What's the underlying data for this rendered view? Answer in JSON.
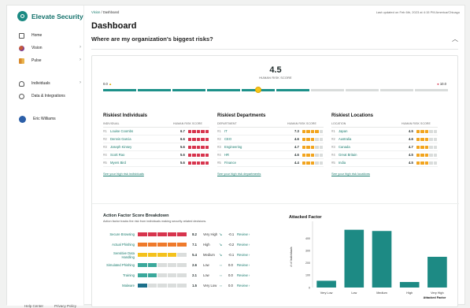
{
  "brand": {
    "name": "Elevate Security",
    "accent": "#1b8a83"
  },
  "sidebar": {
    "items": [
      {
        "label": "Home",
        "icon": "home-icon",
        "chevron": false
      },
      {
        "label": "Vision",
        "icon": "vision-icon",
        "chevron": true
      },
      {
        "label": "Pulse",
        "icon": "pulse-icon",
        "chevron": true
      },
      {
        "label": "Individuals",
        "icon": "people-icon",
        "chevron": true
      },
      {
        "label": "Data & Integrations",
        "icon": "data-icon",
        "chevron": false
      }
    ],
    "user": {
      "name": "Eric Williams"
    },
    "footer": [
      "Help Center",
      "Privacy Policy"
    ]
  },
  "header": {
    "breadcrumb": {
      "root": "Vision",
      "sep": "/",
      "current": "Dashboard"
    },
    "updated": "Last updated on Feb 6th, 2023 at 4:15 PM America/Chicago",
    "title": "Dashboard",
    "subtitle": "Where are my organization's biggest risks?",
    "collapse_glyph": "︿"
  },
  "human_risk": {
    "score": "4.5",
    "label": "HUMAN RISK SCORE",
    "min": "0.0",
    "max": "10.0",
    "segments": 10,
    "filled": 6,
    "value_fraction": 0.45
  },
  "risky": {
    "bar_colors": {
      "high": "#d7344d",
      "mid": "#f2a41d",
      "off": "#d9dcdb"
    },
    "columns": [
      {
        "title": "Riskiest Individuals",
        "col1": "INDIVIDUAL",
        "col2": "HUMAN RISK SCORE",
        "link": "See your high risk individuals",
        "rows": [
          {
            "rank": "#1",
            "name": "Louise Coombs",
            "score": "6.7",
            "level": 5,
            "tone": "high"
          },
          {
            "rank": "#2",
            "name": "Dennis Garcia",
            "score": "6.6",
            "level": 5,
            "tone": "high"
          },
          {
            "rank": "#3",
            "name": "Joseph Kinsey",
            "score": "5.6",
            "level": 5,
            "tone": "high"
          },
          {
            "rank": "#4",
            "name": "Scott Rao",
            "score": "5.6",
            "level": 5,
            "tone": "high"
          },
          {
            "rank": "#5",
            "name": "Myers Bird",
            "score": "5.6",
            "level": 5,
            "tone": "high"
          }
        ]
      },
      {
        "title": "Riskiest Departments",
        "col1": "DEPARTMENT",
        "col2": "HUMAN RISK SCORE",
        "link": "See your high risk departments",
        "rows": [
          {
            "rank": "#1",
            "name": "IT",
            "score": "7.3",
            "level": 4,
            "tone": "mid"
          },
          {
            "rank": "#2",
            "name": "CEO",
            "score": "4.6",
            "level": 3,
            "tone": "mid"
          },
          {
            "rank": "#3",
            "name": "Engineering",
            "score": "4.7",
            "level": 3,
            "tone": "mid"
          },
          {
            "rank": "#4",
            "name": "HR",
            "score": "4.6",
            "level": 3,
            "tone": "mid"
          },
          {
            "rank": "#5",
            "name": "Finance",
            "score": "4.4",
            "level": 3,
            "tone": "mid"
          }
        ]
      },
      {
        "title": "Riskiest Locations",
        "col1": "LOCATION",
        "col2": "HUMAN RISK SCORE",
        "link": "See your high risk locations",
        "rows": [
          {
            "rank": "#1",
            "name": "Japan",
            "score": "4.5",
            "level": 3,
            "tone": "mid"
          },
          {
            "rank": "#2",
            "name": "Australia",
            "score": "4.6",
            "level": 3,
            "tone": "mid"
          },
          {
            "rank": "#3",
            "name": "Canada",
            "score": "4.7",
            "level": 3,
            "tone": "mid"
          },
          {
            "rank": "#4",
            "name": "Great Britain",
            "score": "4.5",
            "level": 3,
            "tone": "mid"
          },
          {
            "rank": "#5",
            "name": "India",
            "score": "4.5",
            "level": 3,
            "tone": "mid"
          }
        ]
      }
    ]
  },
  "action_factors": {
    "title": "Action Factor Score Breakdown",
    "description": "Action factor tracks the risk from individuals making security-related decisions.",
    "review_label": "Review ›",
    "rows": [
      {
        "name": "Secure Browsing",
        "score": "8.2",
        "level": "Very High",
        "delta": "-0.1",
        "filled": 5,
        "color": "#d7344d"
      },
      {
        "name": "Actual Phishing",
        "score": "7.1",
        "level": "High",
        "delta": "-0.2",
        "filled": 5,
        "color": "#ef7a2b"
      },
      {
        "name": "Sensitive Data Handling",
        "score": "5.4",
        "level": "Medium",
        "delta": "-0.1",
        "filled": 4,
        "color": "#f4c21c"
      },
      {
        "name": "Simulated Phishing",
        "score": "2.6",
        "level": "Low",
        "delta": "0.0",
        "filled": 2,
        "color": "#3aa89b"
      },
      {
        "name": "Training",
        "score": "2.1",
        "level": "Low",
        "delta": "0.0",
        "filled": 2,
        "color": "#3aa89b"
      },
      {
        "name": "Malware",
        "score": "1.5",
        "level": "Very Low",
        "delta": "0.0",
        "filled": 1,
        "color": "#1b6f8a"
      }
    ]
  },
  "chart_data": {
    "type": "bar",
    "title": "Attacked Factor",
    "ylabel": "# of Individuals",
    "xlabel": "Attacked Factor",
    "categories": [
      "Very Low",
      "Low",
      "Medium",
      "High",
      "Very High"
    ],
    "values": [
      55,
      470,
      460,
      45,
      250
    ],
    "ylim": [
      0,
      500
    ],
    "yticks": [
      0,
      100,
      200,
      300,
      400
    ],
    "color": "#1d8a84"
  }
}
